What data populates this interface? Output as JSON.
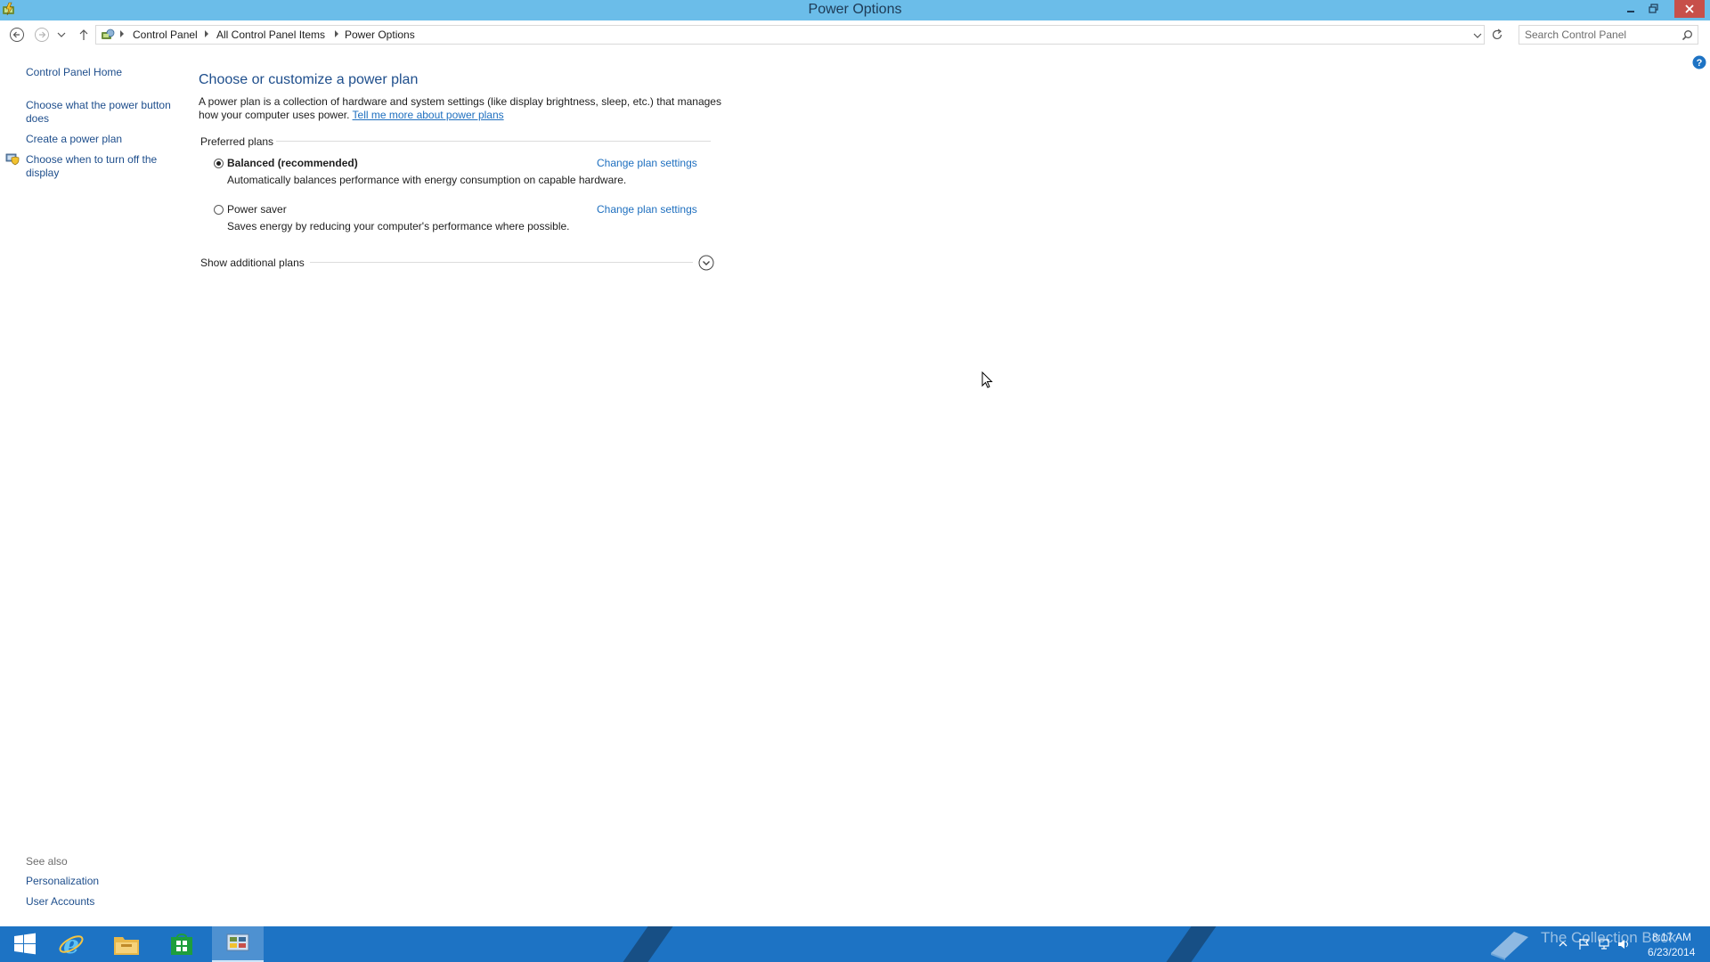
{
  "window": {
    "title": "Power Options"
  },
  "address": {
    "crumbs": [
      "Control Panel",
      "All Control Panel Items",
      "Power Options"
    ],
    "search_placeholder": "Search Control Panel"
  },
  "sidebar": {
    "home": "Control Panel Home",
    "links": [
      "Choose what the power button does",
      "Create a power plan",
      "Choose when to turn off the display"
    ],
    "see_also_title": "See also",
    "see_also": [
      "Personalization",
      "User Accounts"
    ]
  },
  "main": {
    "title": "Choose or customize a power plan",
    "intro": "A power plan is a collection of hardware and system settings (like display brightness, sleep, etc.) that manages how your computer uses power.",
    "intro_link": "Tell me more about power plans",
    "preferred_label": "Preferred plans",
    "plans": [
      {
        "name": "Balanced (recommended)",
        "desc": "Automatically balances performance with energy consumption on capable hardware.",
        "link": "Change plan settings",
        "selected": true
      },
      {
        "name": "Power saver",
        "desc": "Saves energy by reducing your computer's performance where possible.",
        "link": "Change plan settings",
        "selected": false
      }
    ],
    "additional_label": "Show additional plans"
  },
  "taskbar": {
    "watermark": "The Collection Book",
    "time": "8:17 AM",
    "date": "6/23/2014"
  },
  "colors": {
    "titlebar": "#6bbde9",
    "taskbar": "#1d73c4",
    "link": "#1e6fbf",
    "heading": "#1e4e8c"
  }
}
